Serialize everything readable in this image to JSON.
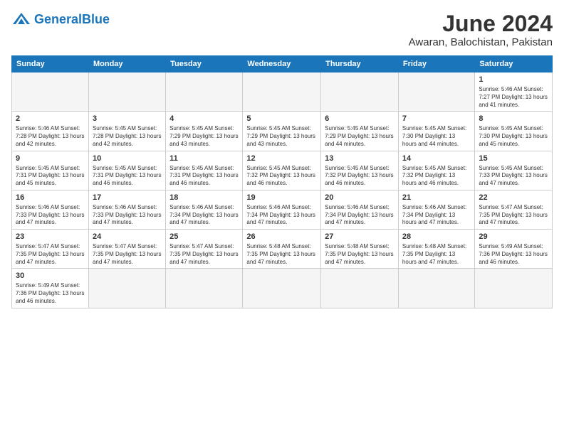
{
  "header": {
    "logo_general": "General",
    "logo_blue": "Blue",
    "title": "June 2024",
    "subtitle": "Awaran, Balochistan, Pakistan"
  },
  "weekdays": [
    "Sunday",
    "Monday",
    "Tuesday",
    "Wednesday",
    "Thursday",
    "Friday",
    "Saturday"
  ],
  "weeks": [
    [
      {
        "day": "",
        "info": ""
      },
      {
        "day": "",
        "info": ""
      },
      {
        "day": "",
        "info": ""
      },
      {
        "day": "",
        "info": ""
      },
      {
        "day": "",
        "info": ""
      },
      {
        "day": "",
        "info": ""
      },
      {
        "day": "1",
        "info": "Sunrise: 5:46 AM\nSunset: 7:27 PM\nDaylight: 13 hours and 41 minutes."
      }
    ],
    [
      {
        "day": "2",
        "info": "Sunrise: 5:46 AM\nSunset: 7:28 PM\nDaylight: 13 hours and 42 minutes."
      },
      {
        "day": "3",
        "info": "Sunrise: 5:45 AM\nSunset: 7:28 PM\nDaylight: 13 hours and 42 minutes."
      },
      {
        "day": "4",
        "info": "Sunrise: 5:45 AM\nSunset: 7:29 PM\nDaylight: 13 hours and 43 minutes."
      },
      {
        "day": "5",
        "info": "Sunrise: 5:45 AM\nSunset: 7:29 PM\nDaylight: 13 hours and 43 minutes."
      },
      {
        "day": "6",
        "info": "Sunrise: 5:45 AM\nSunset: 7:29 PM\nDaylight: 13 hours and 44 minutes."
      },
      {
        "day": "7",
        "info": "Sunrise: 5:45 AM\nSunset: 7:30 PM\nDaylight: 13 hours and 44 minutes."
      },
      {
        "day": "8",
        "info": "Sunrise: 5:45 AM\nSunset: 7:30 PM\nDaylight: 13 hours and 45 minutes."
      }
    ],
    [
      {
        "day": "9",
        "info": "Sunrise: 5:45 AM\nSunset: 7:31 PM\nDaylight: 13 hours and 45 minutes."
      },
      {
        "day": "10",
        "info": "Sunrise: 5:45 AM\nSunset: 7:31 PM\nDaylight: 13 hours and 46 minutes."
      },
      {
        "day": "11",
        "info": "Sunrise: 5:45 AM\nSunset: 7:31 PM\nDaylight: 13 hours and 46 minutes."
      },
      {
        "day": "12",
        "info": "Sunrise: 5:45 AM\nSunset: 7:32 PM\nDaylight: 13 hours and 46 minutes."
      },
      {
        "day": "13",
        "info": "Sunrise: 5:45 AM\nSunset: 7:32 PM\nDaylight: 13 hours and 46 minutes."
      },
      {
        "day": "14",
        "info": "Sunrise: 5:45 AM\nSunset: 7:32 PM\nDaylight: 13 hours and 46 minutes."
      },
      {
        "day": "15",
        "info": "Sunrise: 5:45 AM\nSunset: 7:33 PM\nDaylight: 13 hours and 47 minutes."
      }
    ],
    [
      {
        "day": "16",
        "info": "Sunrise: 5:46 AM\nSunset: 7:33 PM\nDaylight: 13 hours and 47 minutes."
      },
      {
        "day": "17",
        "info": "Sunrise: 5:46 AM\nSunset: 7:33 PM\nDaylight: 13 hours and 47 minutes."
      },
      {
        "day": "18",
        "info": "Sunrise: 5:46 AM\nSunset: 7:34 PM\nDaylight: 13 hours and 47 minutes."
      },
      {
        "day": "19",
        "info": "Sunrise: 5:46 AM\nSunset: 7:34 PM\nDaylight: 13 hours and 47 minutes."
      },
      {
        "day": "20",
        "info": "Sunrise: 5:46 AM\nSunset: 7:34 PM\nDaylight: 13 hours and 47 minutes."
      },
      {
        "day": "21",
        "info": "Sunrise: 5:46 AM\nSunset: 7:34 PM\nDaylight: 13 hours and 47 minutes."
      },
      {
        "day": "22",
        "info": "Sunrise: 5:47 AM\nSunset: 7:35 PM\nDaylight: 13 hours and 47 minutes."
      }
    ],
    [
      {
        "day": "23",
        "info": "Sunrise: 5:47 AM\nSunset: 7:35 PM\nDaylight: 13 hours and 47 minutes."
      },
      {
        "day": "24",
        "info": "Sunrise: 5:47 AM\nSunset: 7:35 PM\nDaylight: 13 hours and 47 minutes."
      },
      {
        "day": "25",
        "info": "Sunrise: 5:47 AM\nSunset: 7:35 PM\nDaylight: 13 hours and 47 minutes."
      },
      {
        "day": "26",
        "info": "Sunrise: 5:48 AM\nSunset: 7:35 PM\nDaylight: 13 hours and 47 minutes."
      },
      {
        "day": "27",
        "info": "Sunrise: 5:48 AM\nSunset: 7:35 PM\nDaylight: 13 hours and 47 minutes."
      },
      {
        "day": "28",
        "info": "Sunrise: 5:48 AM\nSunset: 7:35 PM\nDaylight: 13 hours and 47 minutes."
      },
      {
        "day": "29",
        "info": "Sunrise: 5:49 AM\nSunset: 7:36 PM\nDaylight: 13 hours and 46 minutes."
      }
    ],
    [
      {
        "day": "30",
        "info": "Sunrise: 5:49 AM\nSunset: 7:36 PM\nDaylight: 13 hours and 46 minutes."
      },
      {
        "day": "",
        "info": ""
      },
      {
        "day": "",
        "info": ""
      },
      {
        "day": "",
        "info": ""
      },
      {
        "day": "",
        "info": ""
      },
      {
        "day": "",
        "info": ""
      },
      {
        "day": "",
        "info": ""
      }
    ]
  ]
}
